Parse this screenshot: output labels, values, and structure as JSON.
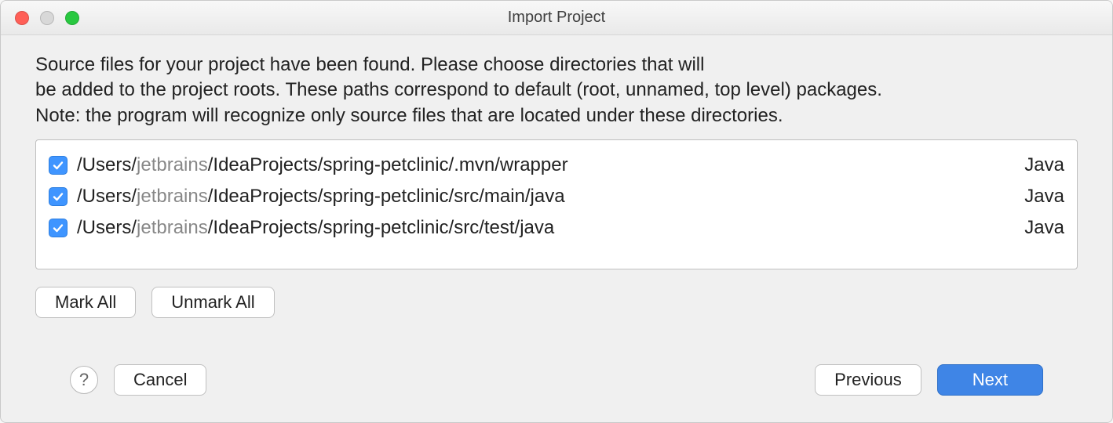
{
  "window": {
    "title": "Import Project"
  },
  "description": {
    "line1": "Source files for your project have been found. Please choose directories that will",
    "line2": "be added to the project roots. These paths correspond to default (root, unnamed, top level) packages.",
    "line3": "Note: the program will recognize only source files that are located under these directories."
  },
  "rows": [
    {
      "checked": true,
      "path_prefix": "/Users/",
      "path_user": "jetbrains",
      "path_suffix": "/IdeaProjects/spring-petclinic/.mvn/wrapper",
      "lang": "Java"
    },
    {
      "checked": true,
      "path_prefix": "/Users/",
      "path_user": "jetbrains",
      "path_suffix": "/IdeaProjects/spring-petclinic/src/main/java",
      "lang": "Java"
    },
    {
      "checked": true,
      "path_prefix": "/Users/",
      "path_user": "jetbrains",
      "path_suffix": "/IdeaProjects/spring-petclinic/src/test/java",
      "lang": "Java"
    }
  ],
  "buttons": {
    "mark_all": "Mark All",
    "unmark_all": "Unmark All",
    "help": "?",
    "cancel": "Cancel",
    "previous": "Previous",
    "next": "Next"
  }
}
